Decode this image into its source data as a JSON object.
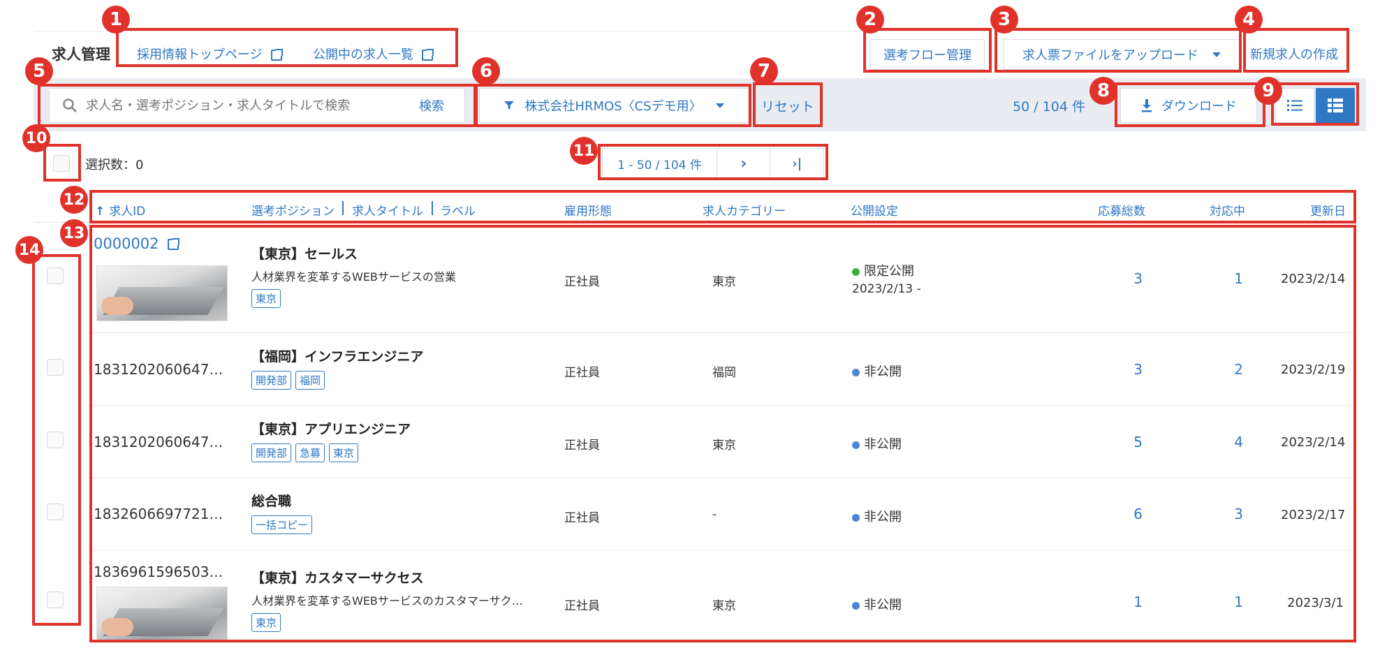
{
  "header": {
    "title": "求人管理",
    "links": [
      "採用情報トップページ",
      "公開中の求人一覧"
    ],
    "flow_button": "選考フロー管理",
    "upload_button": "求人票ファイルをアップロード",
    "create_button": "新規求人の作成"
  },
  "toolbar": {
    "search_placeholder": "求人名・選考ポジション・求人タイトルで検索",
    "search_button": "検索",
    "filter_label": "株式会社HRMOS〈CSデモ用〉",
    "reset": "リセット",
    "count": "50 / 104 件",
    "download": "ダウンロード"
  },
  "selection": {
    "label": "選択数：0"
  },
  "pagination": {
    "range": "1 - 50 / 104 件",
    "next": "›",
    "last": "›|"
  },
  "columns": {
    "id": "求人ID",
    "position": "選考ポジション",
    "job_title": "求人タイトル",
    "label": "ラベル",
    "employment": "雇用形態",
    "category": "求人カテゴリー",
    "publish": "公開設定",
    "applications": "応募総数",
    "in_progress": "対応中",
    "updated": "更新日"
  },
  "rows": [
    {
      "id": "0000002",
      "title": "【東京】セールス",
      "desc": "人材業界を変革するWEBサービスの営業",
      "tags": [
        "東京"
      ],
      "employment": "正社員",
      "category": "東京",
      "status": "限定公開",
      "status_sub": "2023/2/13 -",
      "applications": "3",
      "in_progress": "1",
      "updated": "2023/2/14"
    },
    {
      "id": "1831202060647…",
      "title": "【福岡】インフラエンジニア",
      "desc": "",
      "tags": [
        "開発部",
        "福岡"
      ],
      "employment": "正社員",
      "category": "福岡",
      "status": "非公開",
      "status_sub": "",
      "applications": "3",
      "in_progress": "2",
      "updated": "2023/2/19"
    },
    {
      "id": "1831202060647…",
      "title": "【東京】アプリエンジニア",
      "desc": "",
      "tags": [
        "開発部",
        "急募",
        "東京"
      ],
      "employment": "正社員",
      "category": "東京",
      "status": "非公開",
      "status_sub": "",
      "applications": "5",
      "in_progress": "4",
      "updated": "2023/2/14"
    },
    {
      "id": "1832606697721…",
      "title": "総合職",
      "desc": "",
      "tags": [
        "一括コピー"
      ],
      "employment": "正社員",
      "category": "-",
      "status": "非公開",
      "status_sub": "",
      "applications": "6",
      "in_progress": "3",
      "updated": "2023/2/17"
    },
    {
      "id": "1836961596503…",
      "title": "【東京】カスタマーサクセス",
      "desc": "人材業界を変革するWEBサービスのカスタマーサク…",
      "tags": [
        "東京"
      ],
      "employment": "正社員",
      "category": "東京",
      "status": "非公開",
      "status_sub": "",
      "applications": "1",
      "in_progress": "1",
      "updated": "2023/3/1"
    }
  ],
  "annotations": [
    "1",
    "2",
    "3",
    "4",
    "5",
    "6",
    "7",
    "8",
    "9",
    "10",
    "11",
    "12",
    "13",
    "14"
  ],
  "colors": {
    "accent": "#2f78c4",
    "annotation": "#e0322b",
    "limited": "#3ab03e",
    "private": "#4a86d9",
    "toolbar_bg": "#e9edf2",
    "view_active": "#2f78c4"
  }
}
